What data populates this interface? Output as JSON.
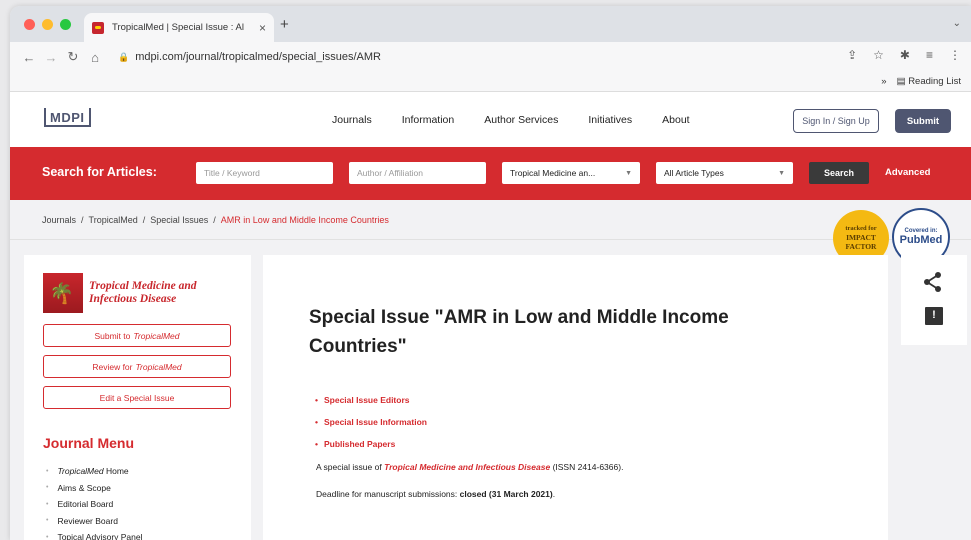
{
  "browser": {
    "tab_title": "TropicalMed | Special Issue : Al",
    "tab_close": "×",
    "new_tab": "+",
    "url": "mdpi.com/journal/tropicalmed/special_issues/AMR",
    "reading_list": "Reading List",
    "bookmarks_more": "»"
  },
  "header": {
    "logo": "MDPI",
    "nav": [
      "Journals",
      "Information",
      "Author Services",
      "Initiatives",
      "About"
    ],
    "sign_in": "Sign In / Sign Up",
    "submit": "Submit"
  },
  "search": {
    "label": "Search for Articles:",
    "title_placeholder": "Title / Keyword",
    "author_placeholder": "Author / Affiliation",
    "journal_select": "Tropical Medicine an...",
    "type_select": "All Article Types",
    "search_button": "Search",
    "advanced": "Advanced"
  },
  "breadcrumb": [
    "Journals",
    "TropicalMed",
    "Special Issues",
    "AMR in Low and Middle Income Countries"
  ],
  "badges": {
    "impact_line1": "tracked for",
    "impact_line2": "IMPACT",
    "impact_line3": "FACTOR",
    "pubmed_small": "Covered in:",
    "pubmed_big": "PubMed"
  },
  "sidebar": {
    "journal_name_line1": "Tropical Medicine and",
    "journal_name_line2": "Infectious Disease",
    "submit_prefix": "Submit to",
    "review_prefix": "Review for",
    "journal_short": "TropicalMed",
    "edit_special_issue": "Edit a Special Issue",
    "menu_title": "Journal Menu",
    "menu_items": [
      "Home",
      "Aims & Scope",
      "Editorial Board",
      "Reviewer Board",
      "Topical Advisory Panel"
    ]
  },
  "content": {
    "title": "Special Issue \"AMR in Low and Middle Income Countries\"",
    "toc": [
      "Special Issue Editors",
      "Special Issue Information",
      "Published Papers"
    ],
    "para1_prefix": "A special issue of",
    "para1_journal": "Tropical Medicine and Infectious Disease",
    "para1_suffix": "(ISSN 2414-6366).",
    "para2_prefix": "Deadline for manuscript submissions:",
    "para2_bold": "closed (31 March 2021)",
    "para2_suffix": "."
  },
  "colors": {
    "brand_red": "#d52b2f",
    "mdpi_navy": "#4f5671"
  }
}
